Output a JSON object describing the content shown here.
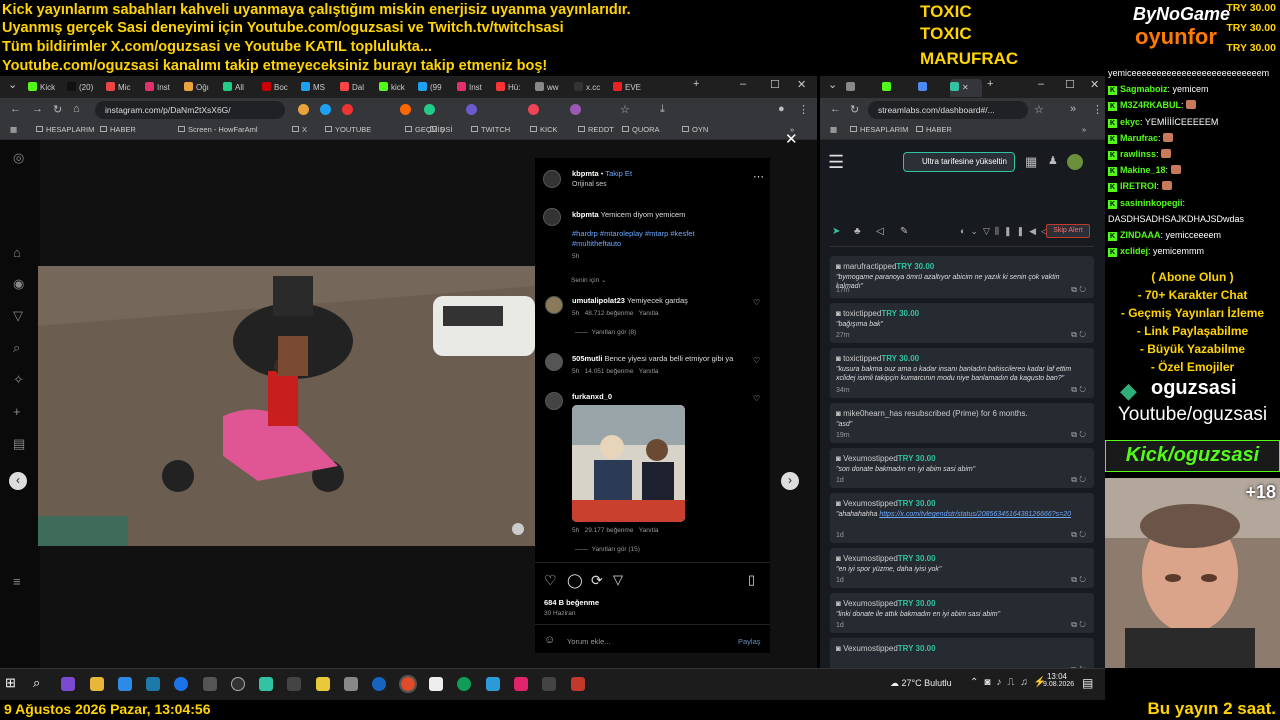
{
  "overlay": {
    "ticker_lines": [
      "Kick yayınlarım sabahları kahveli uyanmaya çalıştığım miskin enerjisiz uyanma yayınlarıdır.",
      "Uyanmış gerçek Sasi deneyimi için Youtube.com/oguzsasi ve Twitch.tv/twitchsasi",
      "Tüm bildirimler X.com/oguzsasi ve Youtube KATIL toplulukta...",
      "Youtube.com/oguzsasi kanalımı takip etmeyeceksiniz burayı takip etmeniz boş!"
    ],
    "recent_names": [
      "TOXIC",
      "TOXIC",
      "MARUFRAC"
    ],
    "recent_amounts": [
      "TRY 30.00",
      "TRY 30.00",
      "TRY 30.00"
    ],
    "logo_top": "ByNoGame",
    "logo_bottom": "oyunfor",
    "bottom_left": "9 Ağustos 2026 Pazar, 13:04:56",
    "bottom_right": "Bu yayın 2 saat."
  },
  "left_browser": {
    "tabs": [
      "Kick",
      "(20)",
      "Mic",
      "Inst",
      "Oğı",
      "All",
      "Boc",
      "MS",
      "Dal",
      "kick",
      "(99",
      "Inst",
      "Hü:",
      "ww",
      "x.cc",
      "EVE"
    ],
    "url": "instagram.com/p/DaNm2tXsX6G/",
    "bookmarks": [
      "HESAPLARIM",
      "HABER",
      "Screen - HowFarAml",
      "X",
      "YOUTUBE",
      "GEÇMİŞ",
      "DSİ",
      "TWITCH",
      "KICK",
      "REDDT",
      "QUORA",
      "OYN"
    ]
  },
  "post": {
    "author": "kbpmta",
    "follow": "Takip Et",
    "audio": "Orijinal ses",
    "caption": "Yemicem diyom yemicem",
    "hashtags": "#hardrp #mtaroleplay #mtarp #kesfet #multitheftauto",
    "caption_age": "5h",
    "for_you": "Senin için",
    "comments": [
      {
        "user": "umutalipolat23",
        "text": "Yemiyecek gardaş",
        "age": "5h",
        "likes": "48.712 beğenme",
        "reply": "Yanıtla",
        "replies": "Yanıtları gör (8)"
      },
      {
        "user": "505mutli",
        "text": "Bence yiyesi varda belli etmiyor gibi ya",
        "age": "5h",
        "likes": "14.051 beğenme",
        "reply": "Yanıtla",
        "replies": ""
      },
      {
        "user": "furkanxd_0",
        "text": "",
        "age": "5h",
        "likes": "29.177 beğenme",
        "reply": "Yanıtla",
        "replies": "Yanıtları gör (15)"
      }
    ],
    "total_likes": "684 B beğenme",
    "date": "30 Haziran",
    "comment_placeholder": "Yorum ekle...",
    "share": "Paylaş"
  },
  "right_browser": {
    "url": "streamlabs.com/dashboard#/...",
    "bookmarks": [
      "HESAPLARIM",
      "HABER"
    ],
    "upgrade": "Ultra tarifesine yükseltin",
    "skip": "Skip Alert",
    "alerts": [
      {
        "name": "marufrac",
        "verb": "tipped",
        "amount": "TRY 30.00",
        "msg": "\"bymogame paranoya ömrü azaltıyor abicim ne yazık ki senin çok vaktin kalmadı\"",
        "time": "17m"
      },
      {
        "name": "toxic",
        "verb": "tipped",
        "amount": "TRY 30.00",
        "msg": "\"bağışıma bak\"",
        "time": "27m"
      },
      {
        "name": "toxic",
        "verb": "tipped",
        "amount": "TRY 30.00",
        "msg": "\"kusura bakma ouz ama o kadar insanı banladın bahiscilereo kadar laf ettim xclidej isimli takipçin kumarcının modu niye banlamadın da kagusto ban?\"",
        "time": "34m"
      },
      {
        "name": "mike0hearn_",
        "verb": "has resubscribed (Prime) for 6 months.",
        "amount": "",
        "msg": "\"asd\"",
        "time": "19m"
      },
      {
        "name": "Vexumos",
        "verb": "tipped",
        "amount": "TRY 30.00",
        "msg": "\"son donate bakmadın en iyi abim sasi abim\"",
        "time": "1d"
      },
      {
        "name": "Vexumos",
        "verb": "tipped",
        "amount": "TRY 30.00",
        "msg": "\"ahahahahha ",
        "link": "https://x.com/tvlegendstr/status/2085634516438126666?s=20",
        "time": "1d"
      },
      {
        "name": "Vexumos",
        "verb": "tipped",
        "amount": "TRY 30.00",
        "msg": "\"en iyi spor yüzme, daha iyisi yok\"",
        "time": "1d"
      },
      {
        "name": "Vexumos",
        "verb": "tipped",
        "amount": "TRY 30.00",
        "msg": "\"linki donate ile attık bakmadın en iyi abim sasi abim\"",
        "time": "1d"
      },
      {
        "name": "Vexumos",
        "verb": "tipped",
        "amount": "TRY 30.00",
        "msg": "",
        "time": ""
      }
    ]
  },
  "chat": [
    {
      "user": "",
      "text": "yemiceeeeeeeeeeeeeeeeeeeeeeeeeem"
    },
    {
      "user": "Sagmaboiz",
      "text": ": yemicem"
    },
    {
      "user": "M3Z4RKABUL",
      "text": ":"
    },
    {
      "user": "ekyc",
      "text": ": YEMİİİİCEEEEEM"
    },
    {
      "user": "Marufrac",
      "text": ":"
    },
    {
      "user": "rawlinss",
      "text": ":"
    },
    {
      "user": "Makine_18",
      "text": ":"
    },
    {
      "user": "IRETROI",
      "text": ":"
    },
    {
      "user": "sasininkopegii",
      "text": ":"
    },
    {
      "user": "",
      "text": "DASDHSADHSAJKDHAJSDwdas"
    },
    {
      "user": "ZINDAAA",
      "text": ": yemicceeeem"
    },
    {
      "user": "xclidej",
      "text": ": yemicemmm"
    }
  ],
  "promo": [
    "( Abone Olun )",
    "- 70+ Karakter Chat",
    "- Geçmiş Yayınları İzleme",
    "- Link Paylaşabilme",
    "- Büyük Yazabilme",
    "- Özel Emojiler"
  ],
  "brand": {
    "name": "oguzsasi",
    "youtube": "Youtube/oguzsasi",
    "kick": "Kick/oguzsasi",
    "plus": "+18"
  },
  "taskbar": {
    "weather": "27°C Bulutlu",
    "time": "13:04",
    "date": "9.08.2026"
  },
  "colors": {
    "accent_yellow": "#ffd400",
    "kick_green": "#53fc18",
    "streamlabs_teal": "#31c3a2"
  }
}
